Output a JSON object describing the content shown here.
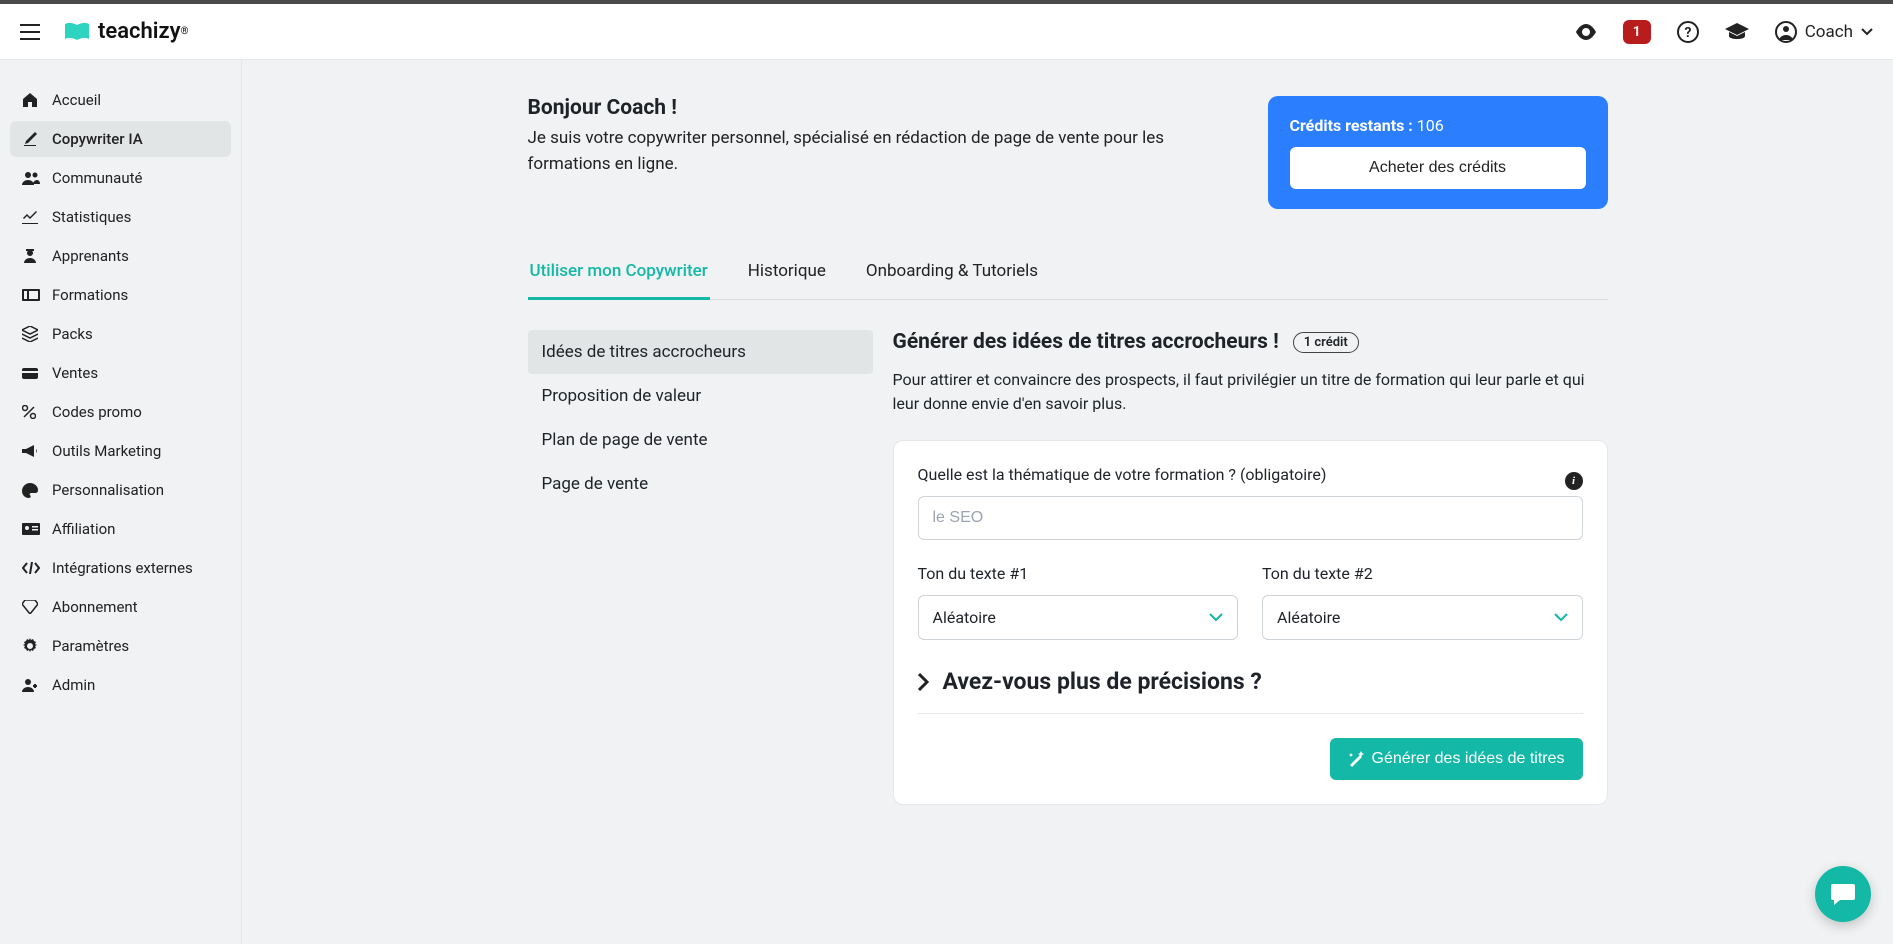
{
  "header": {
    "logo_text": "teachizy",
    "notification_count": "1",
    "user_name": "Coach"
  },
  "sidebar": {
    "items": [
      {
        "label": "Accueil",
        "icon": "home"
      },
      {
        "label": "Copywriter IA",
        "icon": "pen",
        "active": true
      },
      {
        "label": "Communauté",
        "icon": "users"
      },
      {
        "label": "Statistiques",
        "icon": "chart"
      },
      {
        "label": "Apprenants",
        "icon": "student"
      },
      {
        "label": "Formations",
        "icon": "film"
      },
      {
        "label": "Packs",
        "icon": "layers"
      },
      {
        "label": "Ventes",
        "icon": "wallet"
      },
      {
        "label": "Codes promo",
        "icon": "percent"
      },
      {
        "label": "Outils Marketing",
        "icon": "bullhorn"
      },
      {
        "label": "Personnalisation",
        "icon": "palette"
      },
      {
        "label": "Affiliation",
        "icon": "idcard"
      },
      {
        "label": "Intégrations externes",
        "icon": "code"
      },
      {
        "label": "Abonnement",
        "icon": "gem"
      },
      {
        "label": "Paramètres",
        "icon": "gear"
      },
      {
        "label": "Admin",
        "icon": "admin"
      }
    ]
  },
  "main": {
    "greeting": "Bonjour Coach !",
    "intro": "Je suis votre copywriter personnel, spécialisé en rédaction de page de vente pour les formations en ligne.",
    "credits": {
      "label": "Crédits restants :",
      "value": "106",
      "buy_label": "Acheter des crédits"
    },
    "tabs": [
      {
        "label": "Utiliser mon Copywriter",
        "active": true
      },
      {
        "label": "Historique"
      },
      {
        "label": "Onboarding & Tutoriels"
      }
    ],
    "side_menu": [
      {
        "label": "Idées de titres accrocheurs",
        "active": true
      },
      {
        "label": "Proposition de valeur"
      },
      {
        "label": "Plan de page de vente"
      },
      {
        "label": "Page de vente"
      }
    ],
    "content": {
      "title": "Générer des idées de titres accrocheurs !",
      "cost_pill": "1 crédit",
      "desc": "Pour attirer et convaincre des prospects, il faut privilégier un titre de formation qui leur parle et qui leur donne envie d'en savoir plus.",
      "theme_label": "Quelle est la thématique de votre formation ? (obligatoire)",
      "theme_placeholder": "le SEO",
      "tone1_label": "Ton du texte #1",
      "tone1_value": "Aléatoire",
      "tone2_label": "Ton du texte #2",
      "tone2_value": "Aléatoire",
      "expand_label": "Avez-vous plus de précisions ?",
      "generate_label": "Générer des idées de titres"
    }
  }
}
